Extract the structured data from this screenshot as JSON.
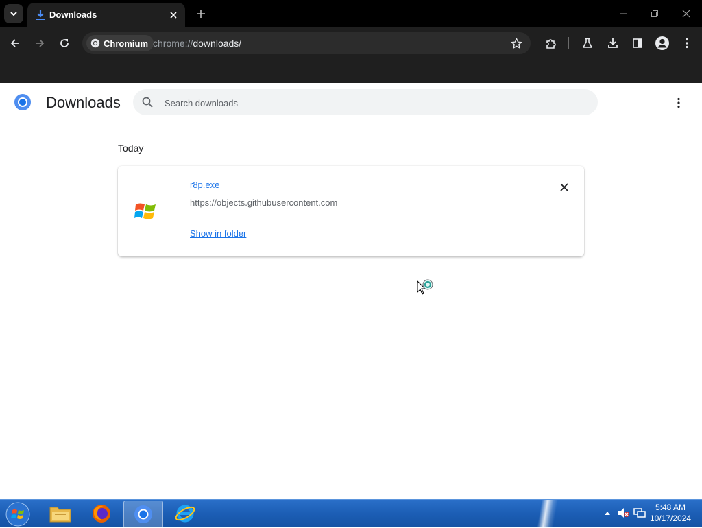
{
  "browser": {
    "tab": {
      "title": "Downloads"
    },
    "omnibox": {
      "chip_label": "Chromium",
      "url_scheme": "chrome://",
      "url_path": "downloads/"
    }
  },
  "page": {
    "title": "Downloads",
    "search": {
      "placeholder": "Search downloads",
      "value": ""
    },
    "date_header": "Today",
    "downloads": [
      {
        "file_name": "r8p.exe",
        "source_url": "https://objects.githubusercontent.com",
        "action_label": "Show in folder"
      }
    ]
  },
  "taskbar": {
    "clock": {
      "time": "5:48 AM",
      "date": "10/17/2024"
    }
  },
  "colors": {
    "link": "#1a73e8",
    "toolbar": "#1f1f1f",
    "tabstrip": "#000000",
    "taskbar": "#1c5eb5"
  },
  "icons": [
    "chevron-down-icon",
    "download-icon",
    "close-icon",
    "plus-icon",
    "minimize-icon",
    "restore-icon",
    "back-arrow-icon",
    "forward-arrow-icon",
    "reload-icon",
    "chromium-icon",
    "star-icon",
    "extensions-icon",
    "labs-flask-icon",
    "download-icon",
    "side-panel-icon",
    "profile-icon",
    "kebab-menu-icon",
    "search-icon",
    "windows-exe-icon",
    "windows-start-icon",
    "folder-icon",
    "firefox-icon",
    "chromium-icon",
    "internet-explorer-icon",
    "tray-arrow-icon",
    "volume-muted-icon",
    "network-icon"
  ]
}
